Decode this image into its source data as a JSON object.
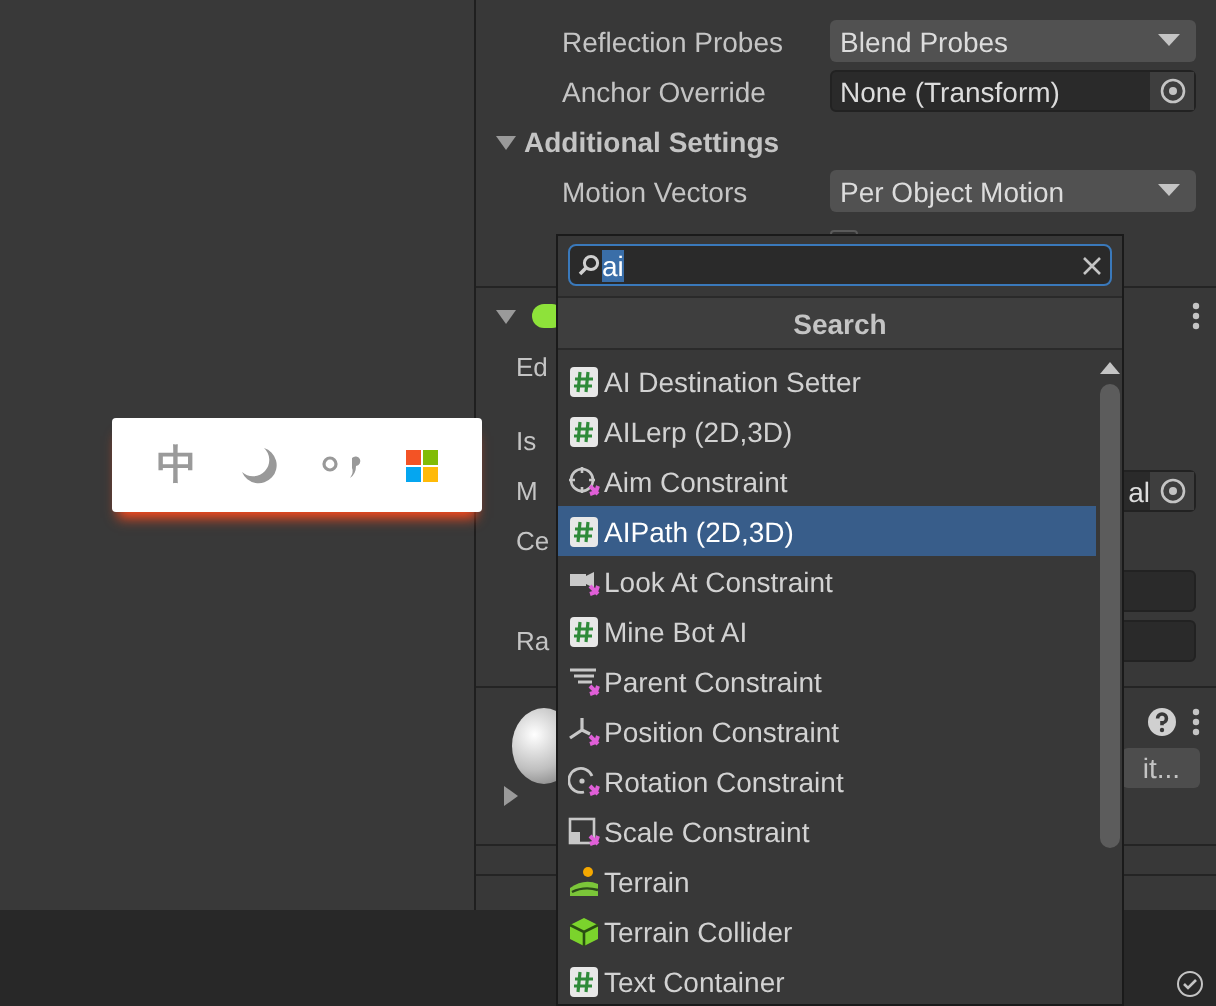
{
  "inspector": {
    "rows": [
      {
        "kind": "dropdown",
        "label": "Reflection Probes",
        "value": "Blend Probes"
      },
      {
        "kind": "object",
        "label": "Anchor Override",
        "value": "None (Transform)"
      },
      {
        "kind": "foldout",
        "label": "Additional Settings",
        "expanded": true
      },
      {
        "kind": "dropdown",
        "label": "Motion Vectors",
        "value": "Per Object Motion"
      },
      {
        "kind": "covered"
      }
    ]
  },
  "component": {
    "expanded": true,
    "rows": [
      {
        "kind": "label",
        "label": "Ed"
      },
      {
        "kind": "gap"
      },
      {
        "kind": "label",
        "label": "Is"
      },
      {
        "kind": "object",
        "label": "M",
        "value": "al"
      },
      {
        "kind": "label",
        "label": "Ce"
      },
      {
        "kind": "field"
      },
      {
        "kind": "field",
        "label": "Ra"
      }
    ]
  },
  "material": {
    "expanded": false,
    "button": "it..."
  },
  "ime_toolbar": {
    "mode": "中"
  },
  "popup": {
    "search": {
      "value": "ai"
    },
    "header": "Search",
    "items": [
      {
        "kind": "script",
        "label": "AI Destination Setter",
        "selected": false
      },
      {
        "kind": "script",
        "label": "AILerp (2D,3D)",
        "selected": false
      },
      {
        "kind": "aim",
        "label": "Aim Constraint",
        "selected": false
      },
      {
        "kind": "script",
        "label": "AIPath (2D,3D)",
        "selected": true
      },
      {
        "kind": "look",
        "label": "Look At Constraint",
        "selected": false
      },
      {
        "kind": "script",
        "label": "Mine Bot AI",
        "selected": false
      },
      {
        "kind": "parent",
        "label": "Parent Constraint",
        "selected": false
      },
      {
        "kind": "position",
        "label": "Position Constraint",
        "selected": false
      },
      {
        "kind": "rotation",
        "label": "Rotation Constraint",
        "selected": false
      },
      {
        "kind": "scale",
        "label": "Scale Constraint",
        "selected": false
      },
      {
        "kind": "terrain",
        "label": "Terrain",
        "selected": false
      },
      {
        "kind": "collider",
        "label": "Terrain Collider",
        "selected": false
      },
      {
        "kind": "script",
        "label": "Text Container",
        "selected": false
      }
    ]
  }
}
